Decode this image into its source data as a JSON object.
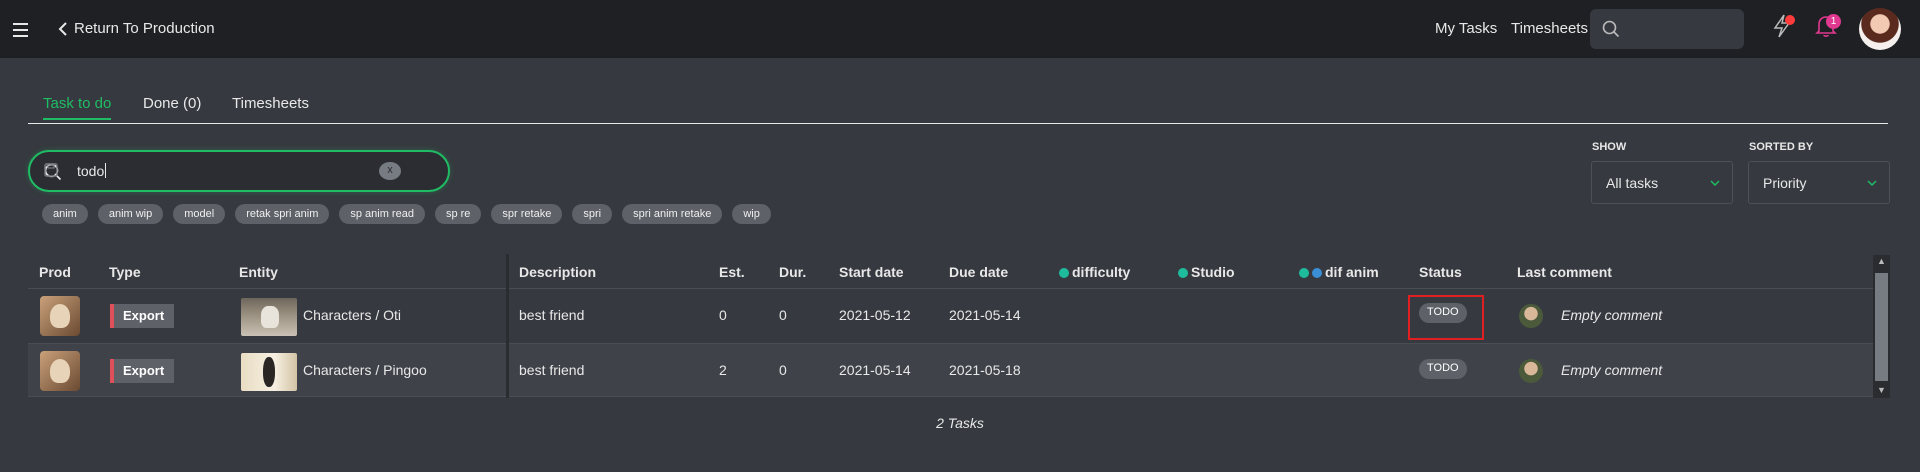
{
  "topbar": {
    "back_label": "Return To Production",
    "my_tasks_label": "My Tasks",
    "timesheets_label": "Timesheets",
    "notification_count": "1"
  },
  "tabs": [
    {
      "label": "Task to do",
      "active": true
    },
    {
      "label": "Done (0)",
      "active": false
    },
    {
      "label": "Timesheets",
      "active": false
    }
  ],
  "filter": {
    "value": "todo",
    "clear_label": "x"
  },
  "chips": [
    "anim",
    "anim wip",
    "model",
    "retak spri anim",
    "sp anim read",
    "sp re",
    "spr retake",
    "spri",
    "spri anim retake",
    "wip"
  ],
  "show": {
    "label": "SHOW",
    "value": "All tasks"
  },
  "sorted_by": {
    "label": "SORTED BY",
    "value": "Priority"
  },
  "columns": {
    "prod": "Prod",
    "type": "Type",
    "entity": "Entity",
    "description": "Description",
    "est": "Est.",
    "dur": "Dur.",
    "start_date": "Start date",
    "due_date": "Due date",
    "difficulty": "difficulty",
    "studio": "Studio",
    "dif_anim": "dif anim",
    "status": "Status",
    "last_comment": "Last comment"
  },
  "rows": [
    {
      "type": "Export",
      "entity": "Characters / Oti",
      "description": "best friend",
      "est": "0",
      "dur": "0",
      "start_date": "2021-05-12",
      "due_date": "2021-05-14",
      "status": "TODO",
      "last_comment": "Empty comment"
    },
    {
      "type": "Export",
      "entity": "Characters / Pingoo",
      "description": "best friend",
      "est": "2",
      "dur": "0",
      "start_date": "2021-05-14",
      "due_date": "2021-05-18",
      "status": "TODO",
      "last_comment": "Empty comment"
    }
  ],
  "footer": {
    "count_label": "2 Tasks"
  },
  "colors": {
    "accent": "#1fbc64",
    "type_bar": "#e0505a",
    "highlight": "#e02020",
    "badge": "#e0398f"
  }
}
